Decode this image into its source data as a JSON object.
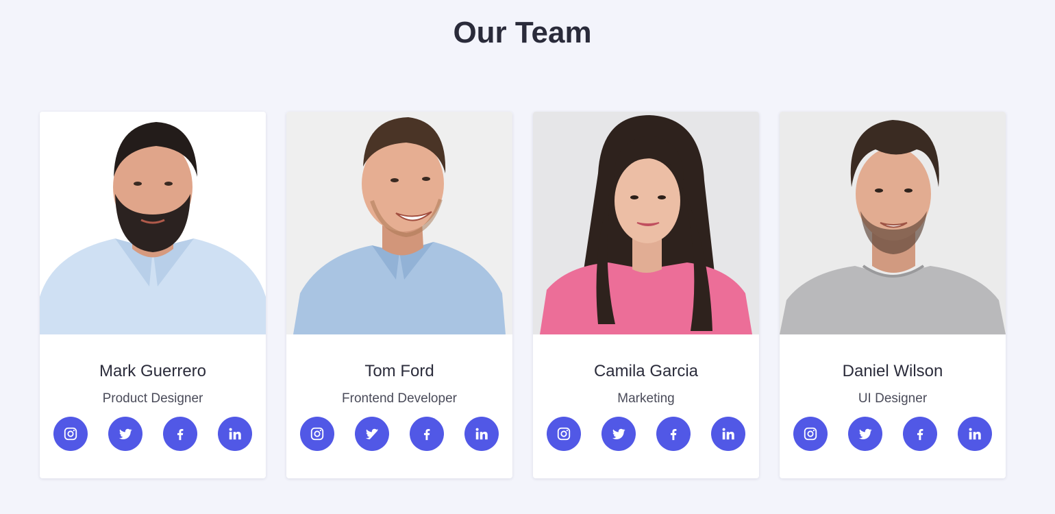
{
  "page": {
    "title": "Our Team"
  },
  "colors": {
    "background": "#f3f4fb",
    "card": "#ffffff",
    "accent": "#5158e6",
    "heading": "#2a2b3a",
    "subtext": "#4a4b59"
  },
  "social_icons": [
    "instagram-icon",
    "twitter-icon",
    "facebook-icon",
    "linkedin-icon"
  ],
  "team": [
    {
      "name": "Mark Guerrero",
      "role": "Product Designer"
    },
    {
      "name": "Tom Ford",
      "role": "Frontend Developer"
    },
    {
      "name": "Camila Garcia",
      "role": "Marketing"
    },
    {
      "name": "Daniel Wilson",
      "role": "UI Designer"
    }
  ]
}
